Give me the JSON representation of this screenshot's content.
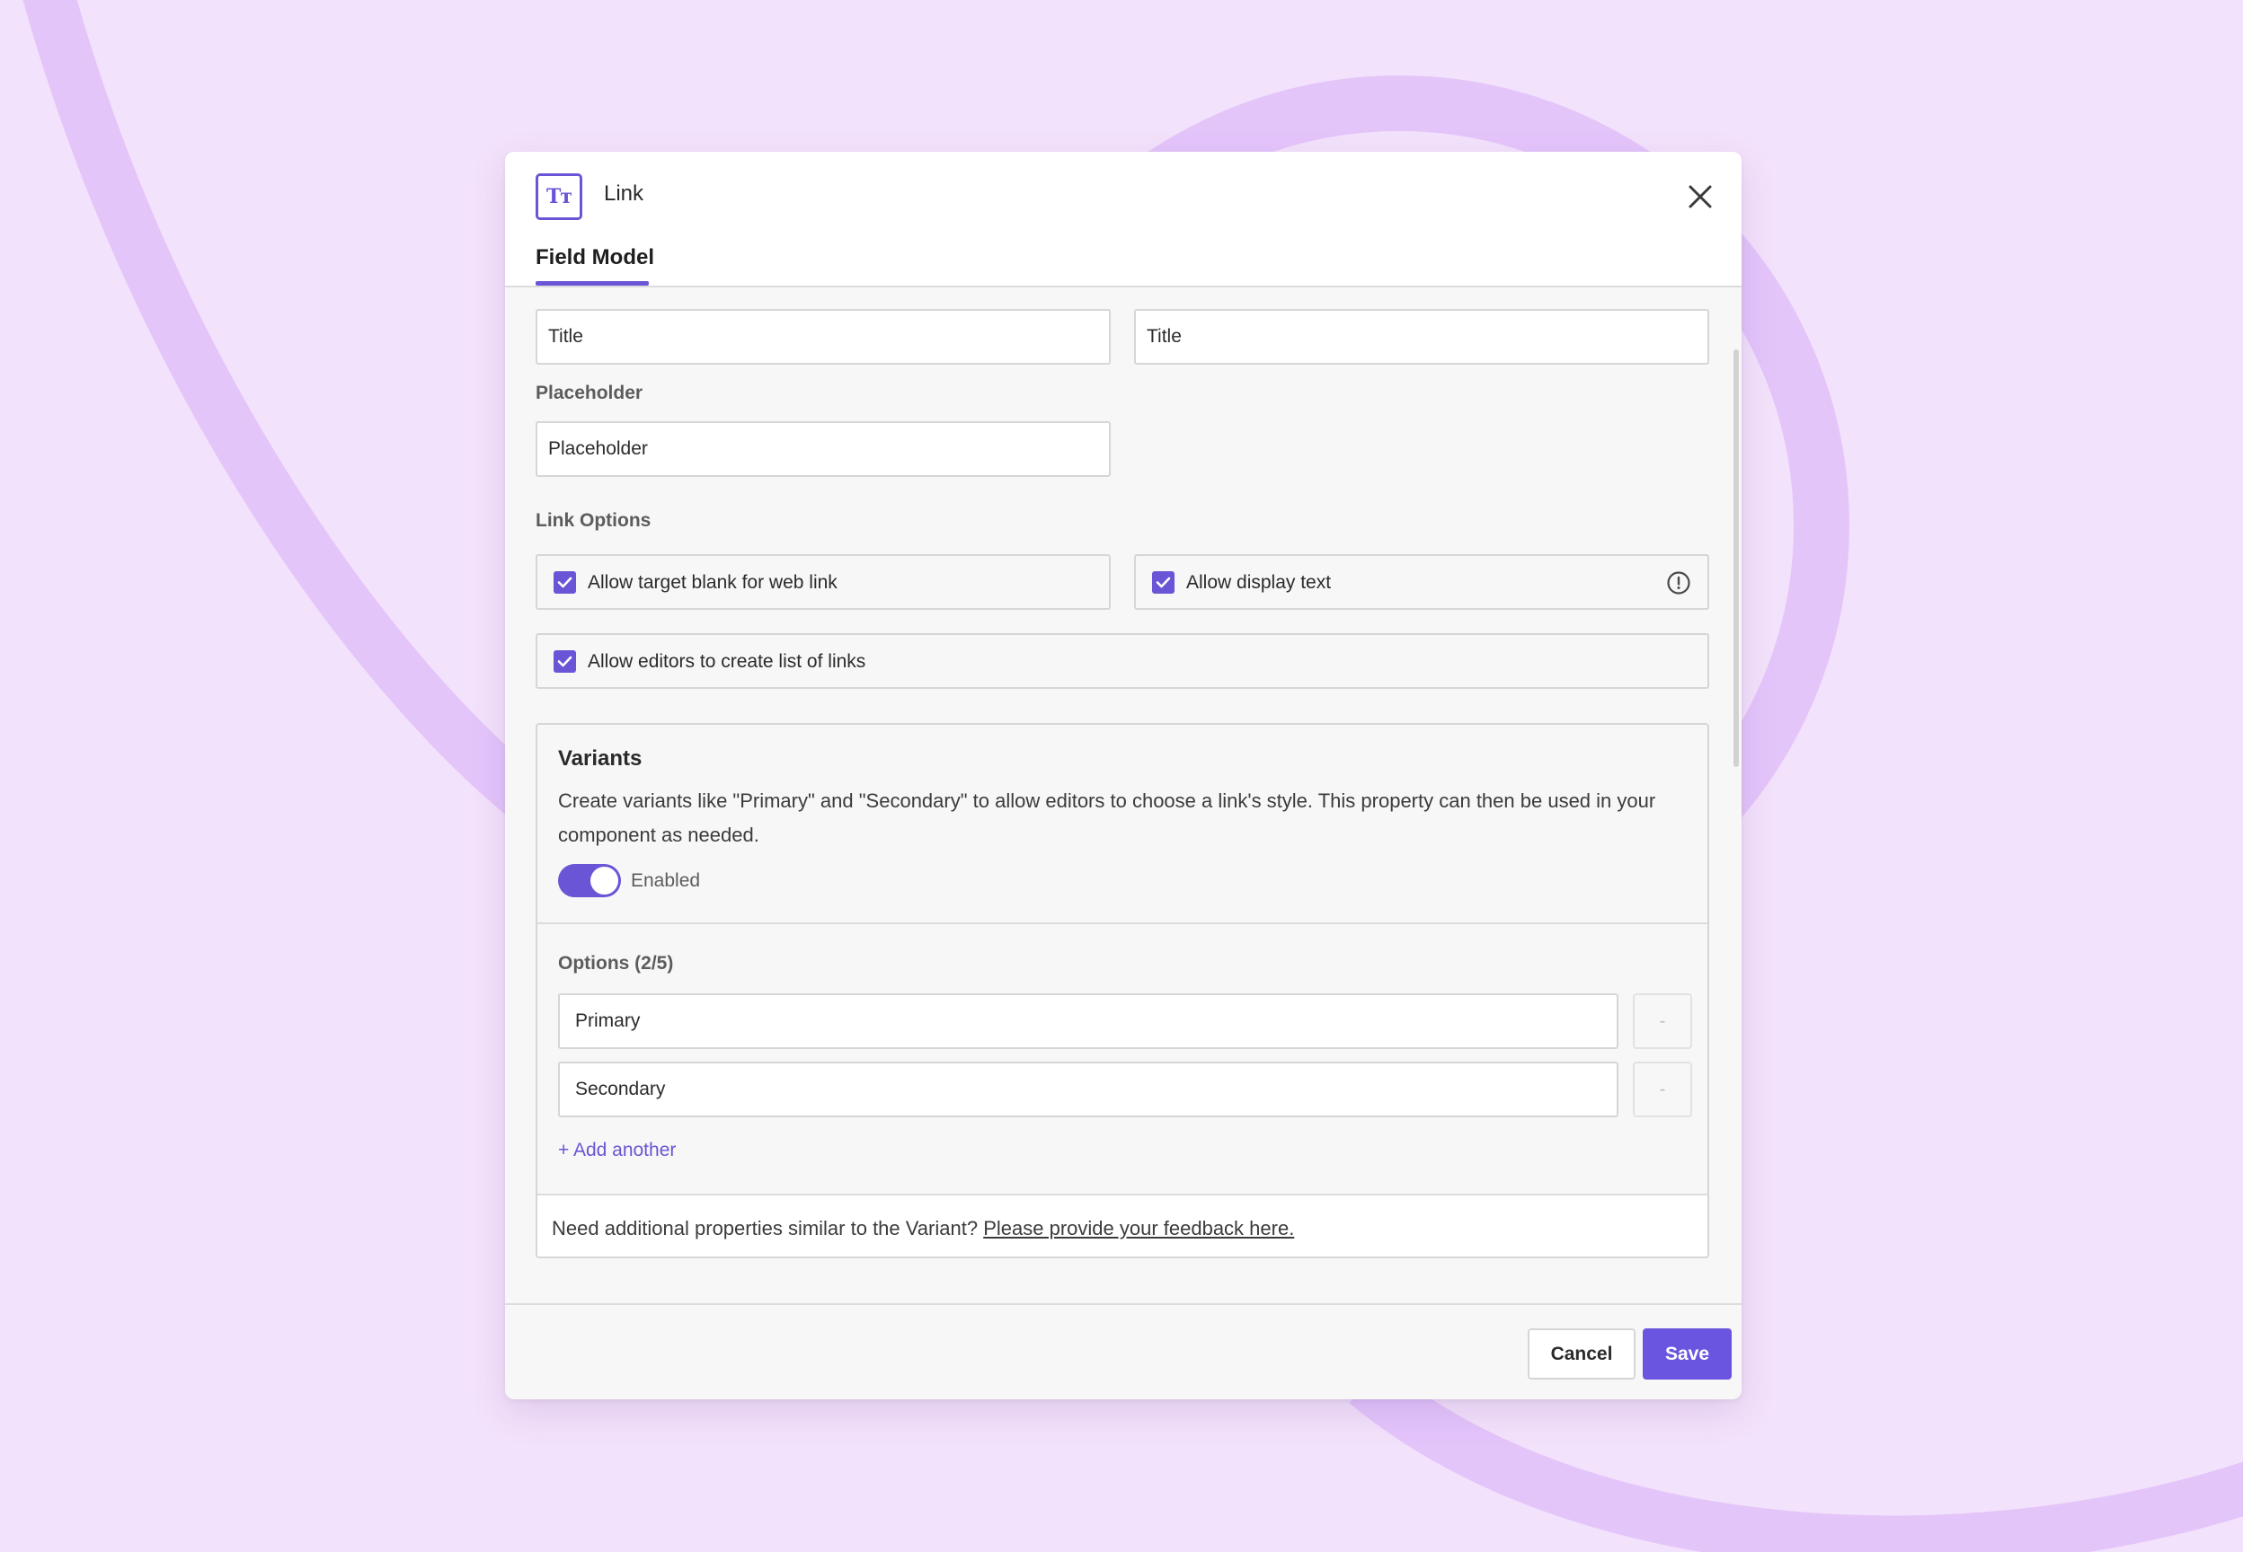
{
  "modal": {
    "type_icon_glyph": "Tт",
    "title": "Link",
    "tab": "Field Model"
  },
  "fields": {
    "title_a": "Title",
    "title_b": "Title",
    "placeholder_label": "Placeholder",
    "placeholder_value": "Placeholder"
  },
  "link_options": {
    "label": "Link Options",
    "target_blank": "Allow target blank for web link",
    "display_text": "Allow display text",
    "list_of_links": "Allow editors to create list of links"
  },
  "variants": {
    "title": "Variants",
    "description": "Create variants like \"Primary\" and \"Secondary\" to allow editors to choose a link's style. This property can then be used in your component as needed.",
    "toggle_label": "Enabled",
    "options_label": "Options (2/5)",
    "options": [
      "Primary",
      "Secondary"
    ],
    "remove_label": "-",
    "add_another": "+ Add another",
    "feedback_prefix": "Need additional properties similar to the Variant?",
    "feedback_link": "Please provide your feedback here."
  },
  "footer": {
    "cancel": "Cancel",
    "save": "Save"
  },
  "colors": {
    "accent": "#6a55d6",
    "background": "#f3e2fb",
    "ring": "#e4c5fa"
  }
}
